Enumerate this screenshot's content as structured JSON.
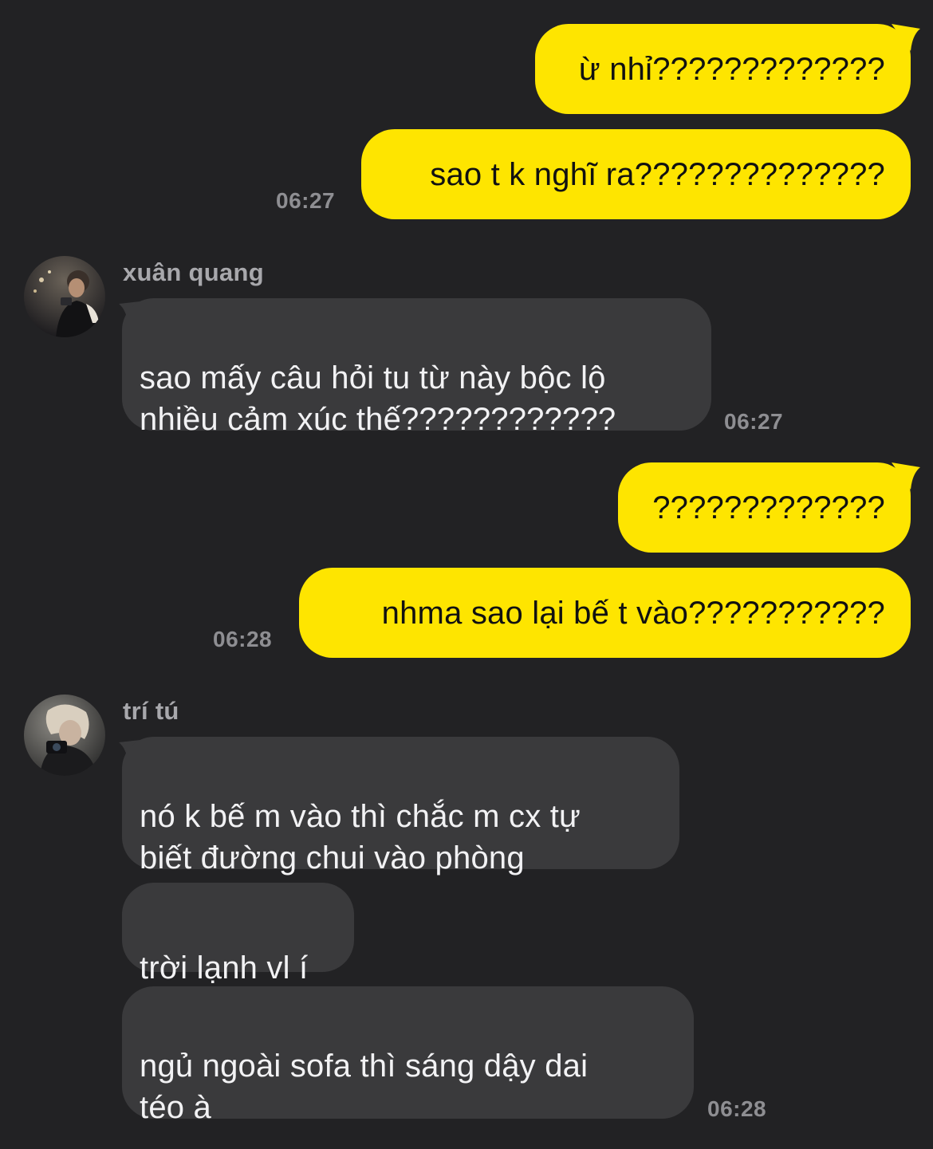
{
  "colors": {
    "background": "#222224",
    "my_bubble": "#FEE500",
    "their_bubble": "#3A3A3C",
    "time_text": "#8E8E92",
    "sender_name": "#A8A8AC"
  },
  "messages": [
    {
      "id": "m1",
      "side": "me",
      "text": "ừ nhỉ?????????????"
    },
    {
      "id": "m2",
      "side": "me",
      "text": "sao t k nghĩ ra??????????????",
      "time": "06:27"
    },
    {
      "id": "m3",
      "side": "them",
      "sender": "xuân quang",
      "avatar": "avatar-photo",
      "text": "sao mấy câu hỏi tu từ này bộc lộ\nnhiều cảm xúc thế????????????",
      "time": "06:27"
    },
    {
      "id": "m4",
      "side": "me",
      "text": "?????????????"
    },
    {
      "id": "m5",
      "side": "me",
      "text": "nhma sao lại bế t vào???????????",
      "time": "06:28"
    },
    {
      "id": "m6",
      "side": "them",
      "sender": "trí tú",
      "avatar": "avatar-photo",
      "text": "nó k bế m vào thì chắc m cx tự\nbiết đường chui vào phòng"
    },
    {
      "id": "m7",
      "side": "them",
      "text": "trời lạnh vl í"
    },
    {
      "id": "m8",
      "side": "them",
      "text": "ngủ ngoài sofa thì sáng dậy dai\ntéo à",
      "time": "06:28"
    }
  ]
}
